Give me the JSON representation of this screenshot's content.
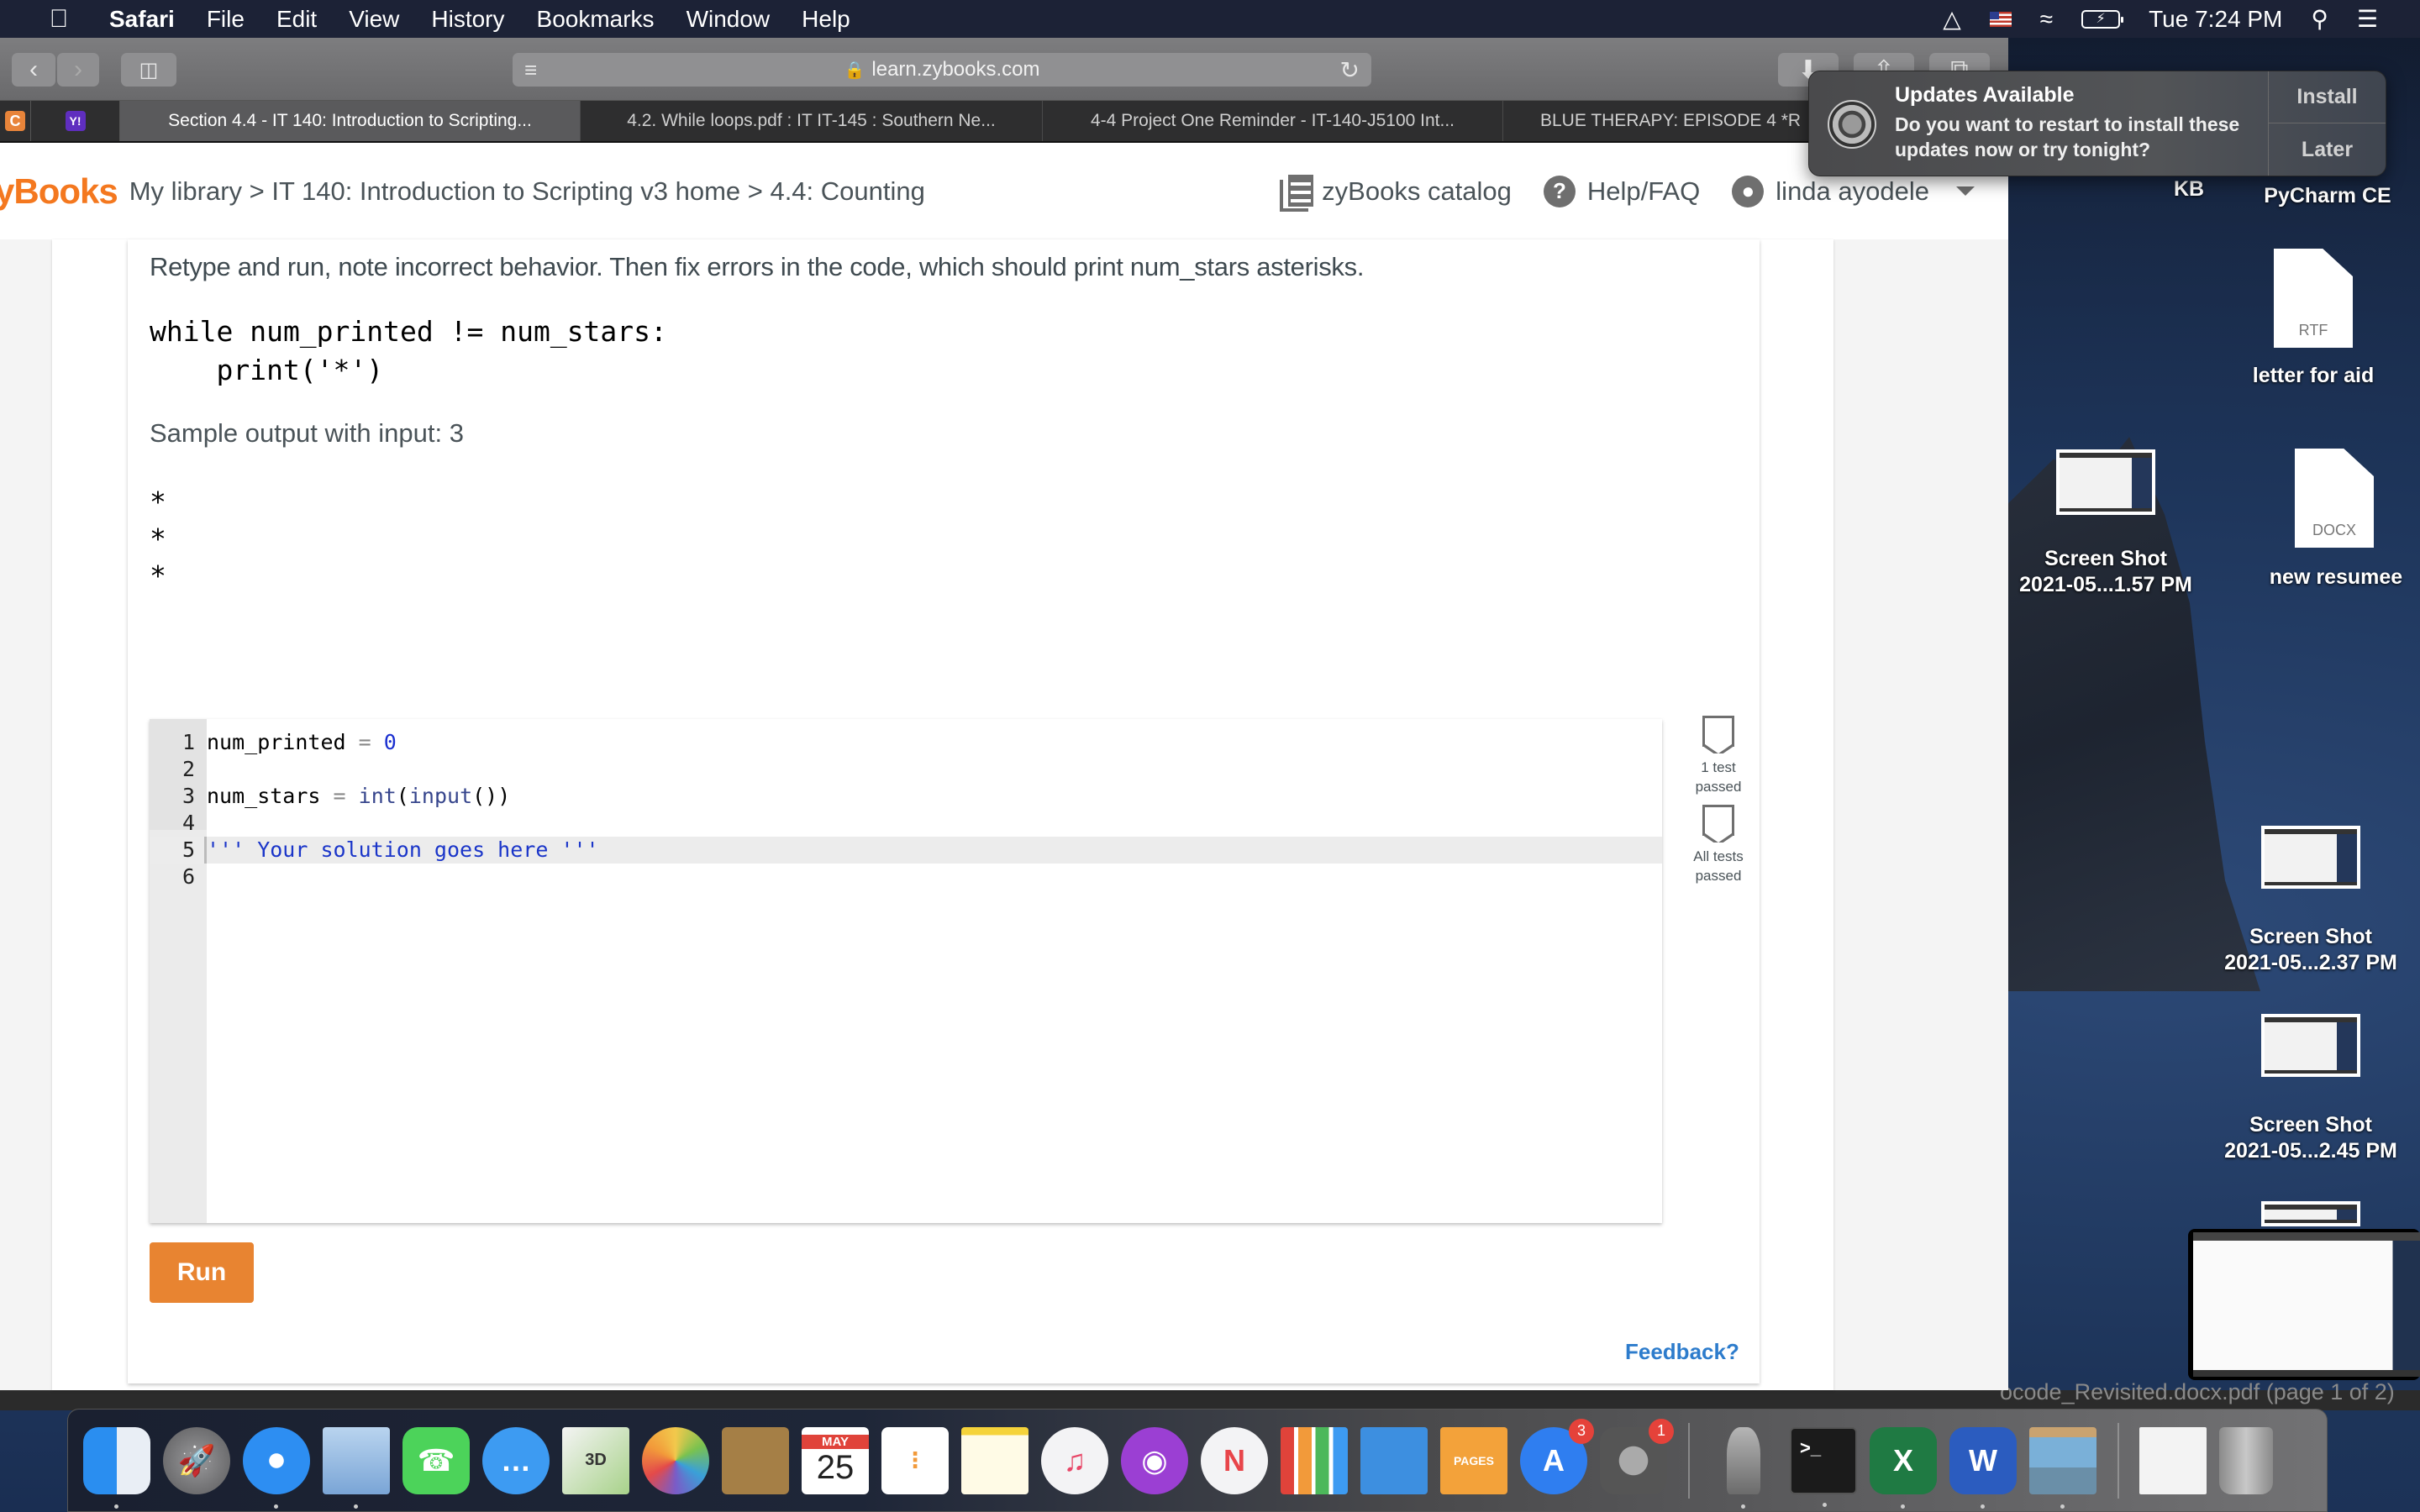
{
  "menubar": {
    "app_name": "Safari",
    "items": [
      "File",
      "Edit",
      "View",
      "History",
      "Bookmarks",
      "Window",
      "Help"
    ],
    "clock": "Tue 7:24 PM",
    "status_icons": [
      "airplay-icon",
      "us-flag-input-icon",
      "wifi-icon",
      "battery-charging-icon"
    ]
  },
  "safari": {
    "address": "learn.zybooks.com",
    "pinned_tabs": [
      {
        "name": "c-pinned-tab",
        "letter": "C",
        "color": "#e8843a"
      },
      {
        "name": "yahoo-pinned-tab",
        "letter": "Y!",
        "color": "#5f2ebf"
      }
    ],
    "tabs": [
      {
        "label": "Section 4.4 - IT 140: Introduction to Scripting...",
        "active": true
      },
      {
        "label": "4.2. While loops.pdf : IT IT-145 : Southern Ne...",
        "active": false
      },
      {
        "label": "4-4 Project One Reminder - IT-140-J5100 Int...",
        "active": false
      },
      {
        "label": "BLUE THERAPY: EPISODE 4 *R",
        "active": false
      }
    ]
  },
  "zybooks": {
    "logo": "yBooks",
    "breadcrumb": "My library > IT 140: Introduction to Scripting v3 home > 4.4: Counting",
    "nav": {
      "catalog": "zyBooks catalog",
      "help": "Help/FAQ",
      "user": "linda ayodele"
    },
    "brand_color": "#f4781f"
  },
  "activity": {
    "instructions": "Retype and run, note incorrect behavior. Then fix errors in the code, which should print num_stars asterisks.",
    "code_lines": [
      "while num_printed != num_stars:",
      "    print('*')"
    ],
    "sample_label": "Sample output with input: 3",
    "sample_output": [
      "*",
      "*",
      "*"
    ],
    "editor_lines": [
      {
        "num": "1",
        "code": "num_printed = 0"
      },
      {
        "num": "2",
        "code": ""
      },
      {
        "num": "3",
        "code": "num_stars = int(input())"
      },
      {
        "num": "4",
        "code": ""
      },
      {
        "num": "5",
        "code": "''' Your solution goes here '''"
      },
      {
        "num": "6",
        "code": ""
      }
    ],
    "tests": [
      {
        "label_line1": "1 test",
        "label_line2": "passed"
      },
      {
        "label_line1": "All tests",
        "label_line2": "passed"
      }
    ],
    "run_label": "Run",
    "feedback_label": "Feedback?",
    "run_color": "#e88431"
  },
  "notification": {
    "title": "Updates Available",
    "body": "Do you want to restart to install these updates now or try tonight?",
    "actions": [
      "Install",
      "Later"
    ]
  },
  "desktop": {
    "items": [
      {
        "label": "KB"
      },
      {
        "label": "PyCharm CE"
      },
      {
        "label": "letter for aid",
        "ext": "RTF"
      },
      {
        "label_line1": "Screen Shot",
        "label_line2": "2021-05...1.57 PM"
      },
      {
        "label": "new resumee",
        "ext": "DOCX"
      },
      {
        "label_line1": "Screen Shot",
        "label_line2": "2021-05...2.37 PM"
      },
      {
        "label_line1": "Screen Shot",
        "label_line2": "2021-05...2.45 PM"
      }
    ],
    "behind_window_title": "ocode_Revisited.docx.pdf (page 1 of 2)"
  },
  "dock": {
    "apps": [
      {
        "name": "finder",
        "running": true
      },
      {
        "name": "launchpad",
        "running": false
      },
      {
        "name": "safari",
        "running": true
      },
      {
        "name": "mail",
        "running": true
      },
      {
        "name": "facetime",
        "running": false
      },
      {
        "name": "messages",
        "running": false
      },
      {
        "name": "maps",
        "running": false
      },
      {
        "name": "photos",
        "running": false
      },
      {
        "name": "contacts",
        "running": false
      },
      {
        "name": "calendar",
        "running": false,
        "month": "MAY",
        "day": "25"
      },
      {
        "name": "reminders",
        "running": false
      },
      {
        "name": "notes",
        "running": false
      },
      {
        "name": "music",
        "running": false
      },
      {
        "name": "podcasts",
        "running": false
      },
      {
        "name": "news",
        "running": false
      },
      {
        "name": "numbers",
        "running": false
      },
      {
        "name": "keynote",
        "running": false
      },
      {
        "name": "pages",
        "running": false
      },
      {
        "name": "app-store",
        "running": false,
        "badge": "3"
      },
      {
        "name": "system-preferences",
        "running": false,
        "badge": "1"
      },
      {
        "name": "python-launcher",
        "running": true
      },
      {
        "name": "terminal",
        "running": true
      },
      {
        "name": "excel",
        "running": true
      },
      {
        "name": "word",
        "running": true
      },
      {
        "name": "preview",
        "running": true
      },
      {
        "name": "recent-document",
        "running": false
      },
      {
        "name": "trash",
        "running": false
      }
    ]
  }
}
